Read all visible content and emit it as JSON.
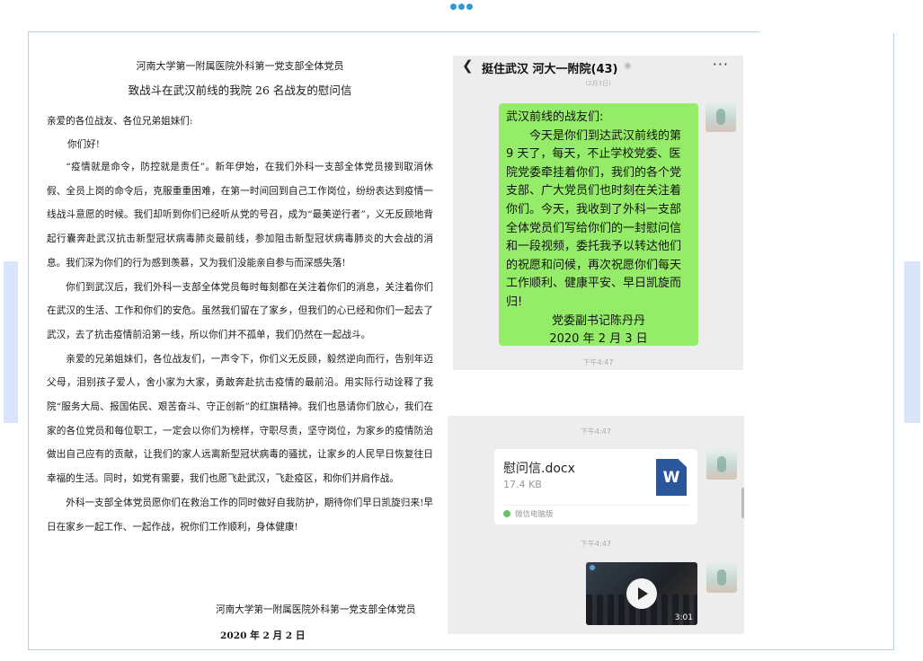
{
  "letter": {
    "title_org": "河南大学第一附属医院外科第一党支部全体党员",
    "title_main": "致战斗在武汉前线的我院 26 名战友的慰问信",
    "salutation": "亲爱的各位战友、各位兄弟姐妹们:",
    "greeting": "你们好!",
    "paragraphs": [
      "“疫情就是命令，防控就是责任”。新年伊始，在我们外科一支部全体党员接到取消休假、全员上岗的命令后，克服重重困难，在第一时间回到自己工作岗位，纷纷表达到疫情一线战斗意愿的时候。我们却听到你们已经听从党的号召，成为“最美逆行者”，义无反顾地背起行囊奔赴武汉抗击新型冠状病毒肺炎最前线，参加阻击新型冠状病毒肺炎的大会战的消息。我们深为你们的行为感到羡慕，又为我们没能亲自参与而深感失落!",
      "你们到武汉后，我们外科一支部全体党员每时每刻都在关注着你们的消息，关注着你们在武汉的生活、工作和你们的安危。虽然我们留在了家乡，但我们的心已经和你们一起去了武汉，去了抗击疫情前沿第一线，所以你们并不孤单，我们仍然在一起战斗。",
      "亲爱的兄弟姐妹们，各位战友们，一声令下，你们义无反顾，毅然逆向而行，告别年迈父母，泪别孩子爱人，舍小家为大家，勇敢奔赴抗击疫情的最前沿。用实际行动诠释了我院“服务大局、报国佑民、艰苦奋斗、守正创新”的红旗精神。我们也恳请你们放心，我们在家的各位党员和每位职工，一定会以你们为榜样，守职尽责，坚守岗位，为家乡的疫情防治做出自己应有的贡献，让我们的家人远离新型冠状病毒的骚扰，让家乡的人民早日恢复往日幸福的生活。同时，如党有需要，我们也愿飞赴武汉，飞赴疫区，和你们并肩作战。",
      "外科一支部全体党员愿你们在救治工作的同时做好自我防护，期待你们早日凯旋归来!早日在家乡一起工作、一起作战，祝你们工作顺利，身体健康!"
    ],
    "signature": "河南大学第一附属医院外科第一党支部全体党员",
    "date": "2020 年 2 月 2 日"
  },
  "chat": {
    "title": "挺住武汉 河大一附院(43)",
    "faint_time": "(2月3日)",
    "message": {
      "greeting": "武汉前线的战友们:",
      "body": "今天是你们到达武汉前线的第 9 天了，每天，不止学校党委、医院党委牵挂着你们，我们的各个党支部、广大党员们也时刻在关注着你们。今天，我收到了外科一支部全体党员们写给你们的一封慰问信和一段视频，委托我予以转达他们的祝愿和问候，再次祝愿你们每天工作顺利、健康平安、早日凯旋而归!",
      "signature": "党委副书记陈丹丹",
      "date": "2020 年 2 月 3 日"
    },
    "times": [
      "下午4:47",
      "下午4:47",
      "下午4:47"
    ],
    "file": {
      "name": "慰问信.docx",
      "size": "17.4 KB",
      "source": "微信电脑版",
      "icon_letter": "W"
    },
    "video": {
      "duration": "3:01"
    }
  },
  "colors": {
    "bubble_green": "#95ec69",
    "chat_bg": "#ededed",
    "frame_border": "#b9cdf0",
    "word_blue": "#2b579a"
  }
}
